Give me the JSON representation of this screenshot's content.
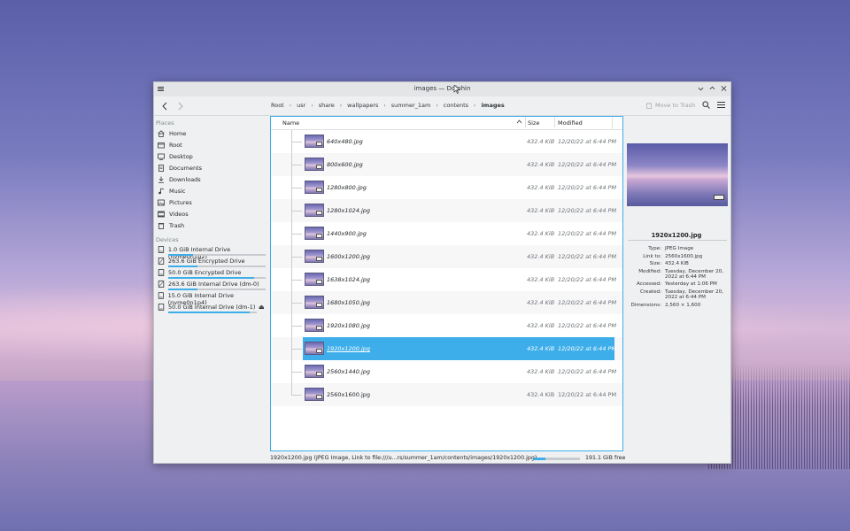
{
  "window": {
    "title": "images — Dolphin"
  },
  "toolbar": {
    "breadcrumb": [
      "Root",
      "usr",
      "share",
      "wallpapers",
      "summer_1am",
      "contents",
      "images"
    ],
    "move_to_trash": "Move to Trash"
  },
  "places": {
    "header": "Places",
    "items": [
      {
        "label": "Home",
        "icon": "home-icon"
      },
      {
        "label": "Root",
        "icon": "folder-icon"
      },
      {
        "label": "Desktop",
        "icon": "desktop-icon"
      },
      {
        "label": "Documents",
        "icon": "documents-icon"
      },
      {
        "label": "Downloads",
        "icon": "downloads-icon"
      },
      {
        "label": "Music",
        "icon": "music-icon"
      },
      {
        "label": "Pictures",
        "icon": "pictures-icon"
      },
      {
        "label": "Videos",
        "icon": "videos-icon"
      },
      {
        "label": "Trash",
        "icon": "trash-icon"
      }
    ]
  },
  "devices": {
    "header": "Devices",
    "items": [
      {
        "label": "1.0 GiB Internal Drive (nvme0n1p2)",
        "usage": 0.25
      },
      {
        "label": "263.6 GiB Encrypted Drive",
        "usage": 0.3
      },
      {
        "label": "50.0 GiB Encrypted Drive",
        "usage": 0.88
      },
      {
        "label": "263.6 GiB Internal Drive (dm-0)",
        "usage": 0.3
      },
      {
        "label": "15.0 GiB Internal Drive (nvme0n1p4)",
        "usage": 0
      },
      {
        "label": "50.0 GiB Internal Drive (dm-1)",
        "usage": 0.92
      }
    ]
  },
  "columns": {
    "name": "Name",
    "size": "Size",
    "modified": "Modified"
  },
  "files": [
    {
      "name": "640x480.jpg",
      "size": "432.4 KiB",
      "modified": "12/20/22 at 6:44 PM"
    },
    {
      "name": "800x600.jpg",
      "size": "432.4 KiB",
      "modified": "12/20/22 at 6:44 PM"
    },
    {
      "name": "1280x800.jpg",
      "size": "432.4 KiB",
      "modified": "12/20/22 at 6:44 PM"
    },
    {
      "name": "1280x1024.jpg",
      "size": "432.4 KiB",
      "modified": "12/20/22 at 6:44 PM"
    },
    {
      "name": "1440x900.jpg",
      "size": "432.4 KiB",
      "modified": "12/20/22 at 6:44 PM"
    },
    {
      "name": "1600x1200.jpg",
      "size": "432.4 KiB",
      "modified": "12/20/22 at 6:44 PM"
    },
    {
      "name": "1638x1024.jpg",
      "size": "432.4 KiB",
      "modified": "12/20/22 at 6:44 PM"
    },
    {
      "name": "1680x1050.jpg",
      "size": "432.4 KiB",
      "modified": "12/20/22 at 6:44 PM"
    },
    {
      "name": "1920x1080.jpg",
      "size": "432.4 KiB",
      "modified": "12/20/22 at 6:44 PM"
    },
    {
      "name": "1920x1200.jpg",
      "size": "432.4 KiB",
      "modified": "12/20/22 at 6:44 PM"
    },
    {
      "name": "2560x1440.jpg",
      "size": "432.4 KiB",
      "modified": "12/20/22 at 6:44 PM"
    },
    {
      "name": "2560x1600.jpg",
      "size": "432.4 KiB",
      "modified": "12/20/22 at 6:44 PM"
    }
  ],
  "selected_file": "1920x1200.jpg",
  "info": {
    "name": "1920x1200.jpg",
    "rows": [
      {
        "key": "Type:",
        "value": "JPEG Image"
      },
      {
        "key": "Link to:",
        "value": "2560x1600.jpg"
      },
      {
        "key": "Size:",
        "value": "432.4 KiB"
      },
      {
        "key": "Modified:",
        "value": "Tuesday, December 20, 2022 at 6:44 PM"
      },
      {
        "key": "Accessed:",
        "value": "Yesterday at 1:06 PM"
      },
      {
        "key": "Created:",
        "value": "Tuesday, December 20, 2022 at 6:44 PM"
      },
      {
        "key": "Dimensions:",
        "value": "2,560 × 1,600"
      }
    ]
  },
  "status": {
    "text": "1920x1200.jpg (JPEG Image, Link to file:///u...rs/summer_1am/contents/images/1920x1200.jpg)",
    "free": "191.1 GiB free",
    "used_fraction": 0.25
  },
  "colors": {
    "accent": "#3daee9",
    "window_bg": "#eff0f1"
  }
}
